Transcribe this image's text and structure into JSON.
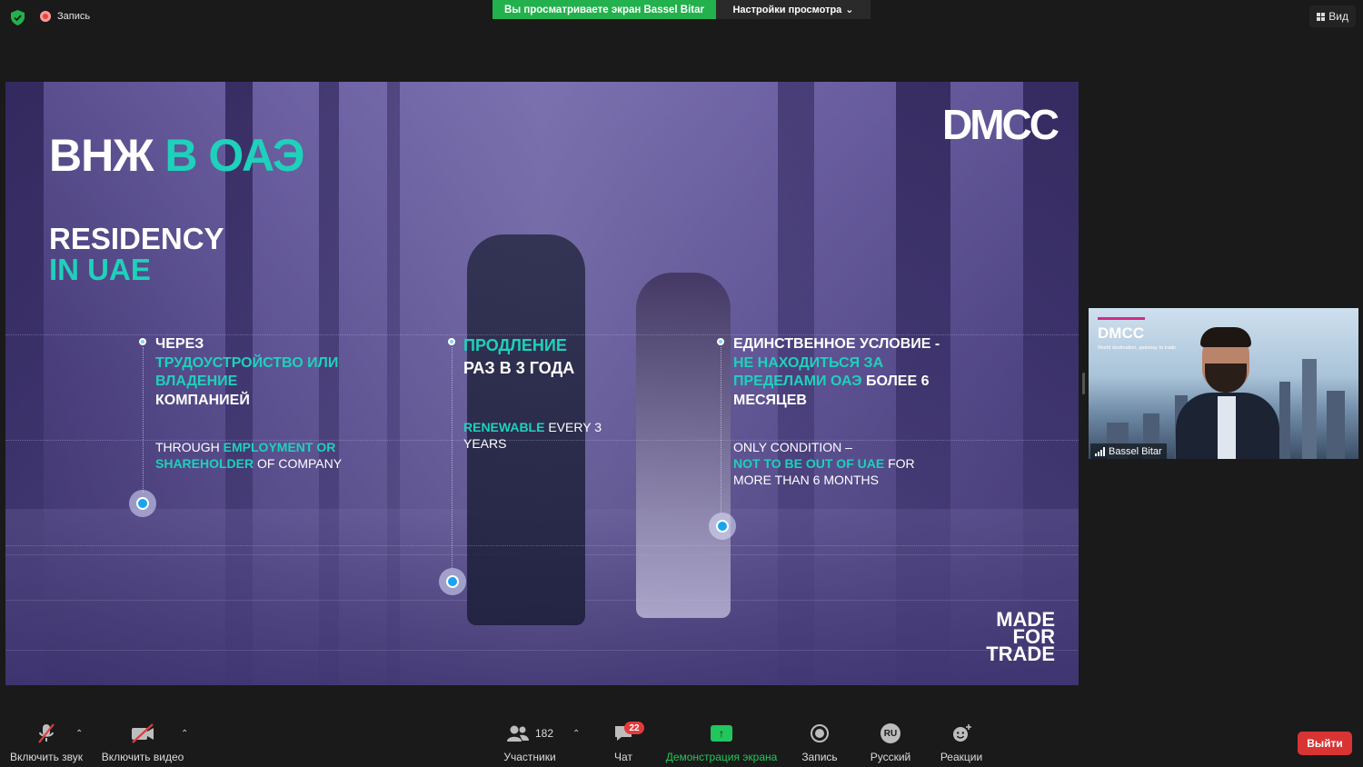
{
  "topbar": {
    "recording_label": "Запись",
    "share_banner": "Вы просматриваете экран Bassel Bitar",
    "view_settings": "Настройки просмотра",
    "view_button": "Вид"
  },
  "slide": {
    "logo": "DMCC",
    "title_ru_1": "ВНЖ",
    "title_ru_2": "В ОАЭ",
    "title_en_1": "RESIDENCY",
    "title_en_2": "IN UAE",
    "made_for_trade": [
      "MADE",
      "FOR",
      "TRADE"
    ],
    "col1": {
      "ru_1": "ЧЕРЕЗ",
      "ru_2": "ТРУДОУСТРОЙСТВО ИЛИ ВЛАДЕНИЕ",
      "ru_3": "КОМПАНИЕЙ",
      "en_1": "THROUGH",
      "en_2": "EMPLOYMENT OR SHAREHOLDER",
      "en_3": "OF COMPANY"
    },
    "col2": {
      "ru_1": "ПРОДЛЕНИЕ",
      "ru_2": "РАЗ В 3 ГОДА",
      "en_1": "RENEWABLE",
      "en_2": "EVERY 3 YEARS"
    },
    "col3": {
      "ru_1": "ЕДИНСТВЕННОЕ УСЛОВИЕ -",
      "ru_2": "НЕ НАХОДИТЬСЯ ЗА ПРЕДЕЛАМИ ОАЭ",
      "ru_3": "БОЛЕЕ 6 МЕСЯЦЕВ",
      "en_1": "ONLY CONDITION –",
      "en_2": "NOT TO BE OUT OF UAE",
      "en_3": "FOR MORE THAN 6 MONTHS"
    }
  },
  "video": {
    "logo": "DMCC",
    "tagline": "World destination, gateway to trade",
    "participant_name": "Bassel Bitar"
  },
  "toolbar": {
    "mute_label": "Включить звук",
    "video_label": "Включить видео",
    "participants_label": "Участники",
    "participants_count": "182",
    "chat_label": "Чат",
    "chat_badge": "22",
    "share_label": "Демонстрация экрана",
    "record_label": "Запись",
    "language_label": "Русский",
    "language_code": "RU",
    "reactions_label": "Реакции",
    "leave_label": "Выйти"
  },
  "colors": {
    "accent_teal": "#1ed1bb",
    "share_green": "#22b14c",
    "leave_red": "#d83434"
  }
}
